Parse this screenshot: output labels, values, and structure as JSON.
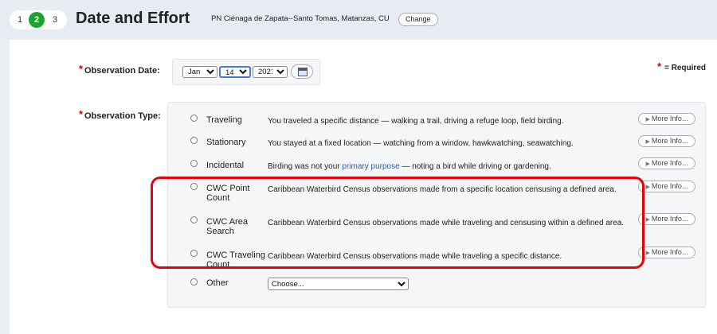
{
  "header": {
    "steps": [
      "1",
      "2",
      "3"
    ],
    "active_step": "2",
    "title": "Date and Effort",
    "location": "PN Ciénaga de Zapata--Santo Tomas, Matanzas, CU",
    "change_label": "Change"
  },
  "required_note": {
    "star": "*",
    "label": "= Required"
  },
  "date": {
    "label": "Observation Date:",
    "star": "*",
    "month": "Jan",
    "day": "14",
    "year": "2021"
  },
  "obs_type": {
    "label": "Observation Type:",
    "star": "*",
    "more_label": "More Info...",
    "options": [
      {
        "name": "Traveling",
        "desc": "You traveled a specific distance — walking a trail, driving a refuge loop, field birding."
      },
      {
        "name": "Stationary",
        "desc": "You stayed at a fixed location — watching from a window, hawkwatching, seawatching."
      },
      {
        "name": "Incidental",
        "desc_before": "Birding was not your ",
        "desc_link": "primary purpose",
        "desc_after": " — noting a bird while driving or gardening."
      },
      {
        "name": "CWC Point Count",
        "desc": "Caribbean Waterbird Census observations made from a specific location censusing a defined area."
      },
      {
        "name": "CWC Area Search",
        "desc": "Caribbean Waterbird Census observations made while traveling and censusing within a defined area."
      },
      {
        "name": "CWC Traveling Count",
        "desc": "Caribbean Waterbird Census observations made while traveling a specific distance."
      },
      {
        "name": "Other",
        "select_value": "Choose..."
      }
    ]
  },
  "colors": {
    "active_step": "#1aa32e",
    "required": "#d40000",
    "highlight": "#e8000b",
    "link": "#2060c0"
  }
}
